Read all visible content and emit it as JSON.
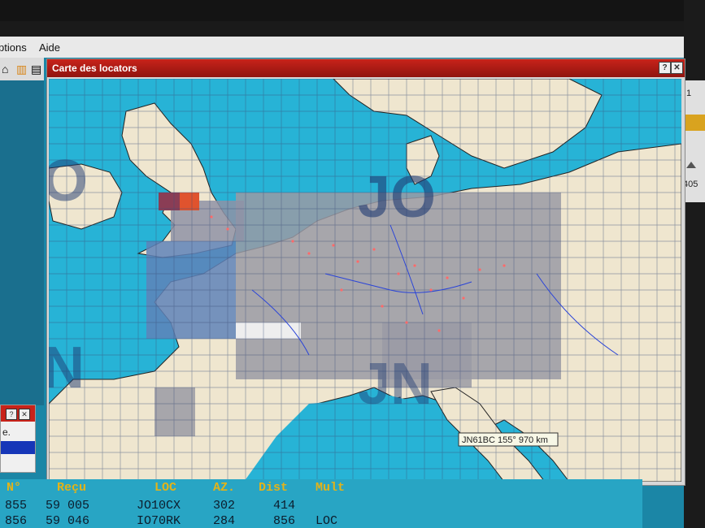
{
  "menu": {
    "options_label": "ptions",
    "help_label": "Aide"
  },
  "window": {
    "title": "Carte des locators",
    "help_btn": "?",
    "close_btn": "✕"
  },
  "map": {
    "field_labels": [
      "JO",
      "JN",
      "IO",
      "IN"
    ],
    "tooltip": "JN61BC 155° 970 km",
    "colors": {
      "sea": "#27b3d6",
      "land": "#efe6cf",
      "worked": "#9a9aa4",
      "border": "#222222"
    }
  },
  "right_panel": {
    "value_top": "1",
    "value_bottom": "405"
  },
  "small_dialog": {
    "help_btn": "?",
    "close_btn": "✕",
    "text": "e."
  },
  "log": {
    "headers": [
      "N°",
      "Reçu",
      "LOC",
      "AZ.",
      "Dist",
      "Mult"
    ],
    "rows": [
      [
        "855",
        "59 005",
        "JO10CX",
        "302",
        "414",
        ""
      ],
      [
        "856",
        "59 046",
        "IO70RK",
        "284",
        "856",
        "LOC"
      ]
    ]
  }
}
